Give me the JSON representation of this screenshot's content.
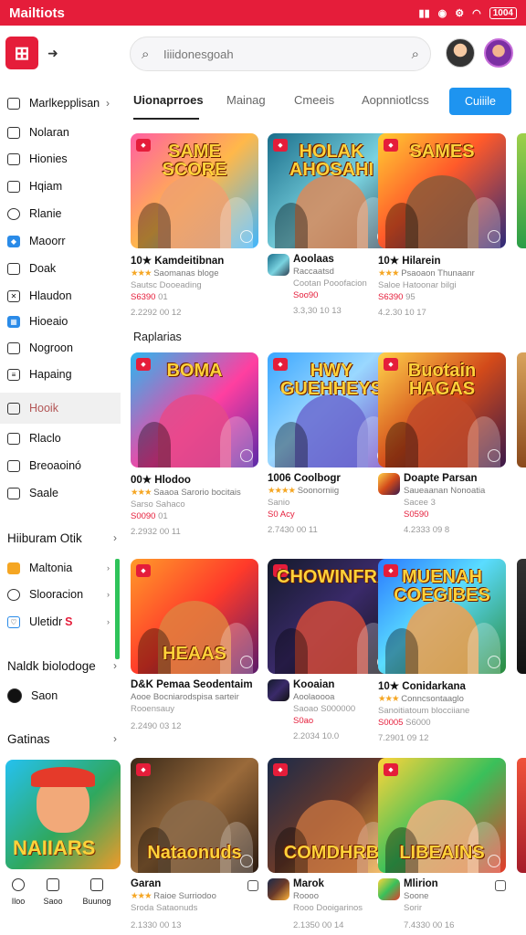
{
  "status_bar": {
    "app_name": "Mailtiots",
    "battery": "1004"
  },
  "search": {
    "placeholder": "Iiiidonesgoah"
  },
  "sidebar": {
    "items": [
      {
        "label": "Marlkepplisan",
        "chevron": "›",
        "icon": "box-icon"
      },
      {
        "label": "Nolaran",
        "icon": "chat-icon"
      },
      {
        "label": "Hionies",
        "icon": "list-icon"
      },
      {
        "label": "Hqiam",
        "icon": "image-icon"
      },
      {
        "label": "Rlanie",
        "icon": "clock-icon"
      },
      {
        "label": "Maoorr",
        "icon": "diamond-icon"
      },
      {
        "label": "Doak",
        "icon": "doc-icon"
      },
      {
        "label": "Hlaudon",
        "icon": "mail-icon"
      },
      {
        "label": "Hioeaio",
        "icon": "grid-icon"
      },
      {
        "label": "Nogroon",
        "icon": "card-icon"
      },
      {
        "label": "Hapaing",
        "icon": "menu-icon"
      },
      {
        "label": "Hooik",
        "icon": "folder-icon",
        "active": true
      },
      {
        "label": "Rlaclo",
        "icon": "check-icon"
      },
      {
        "label": "Breoaoinó",
        "icon": "doc2-icon"
      },
      {
        "label": "Saale",
        "icon": "tag-icon"
      }
    ],
    "section2": {
      "title": "Hiiburam Otik",
      "chevron": "›"
    },
    "items2": [
      {
        "label": "Maltonia",
        "icon": "orange-icon",
        "extra": "›"
      },
      {
        "label": "Slooracion",
        "icon": "pin-icon",
        "extra": "›"
      },
      {
        "label": "Uletidr",
        "badge": "S",
        "icon": "heart-icon",
        "extra": "›"
      }
    ],
    "section3": {
      "title": "Naldk biolodoge",
      "chevron": "›"
    },
    "items3": [
      {
        "label": "Saon",
        "icon": "dot-icon"
      }
    ],
    "section4": {
      "title": "Gatinas",
      "chevron": "›"
    },
    "side_thumb_title": "NAIIARS",
    "bottom_nav": [
      {
        "label": "Iloo"
      },
      {
        "label": "Saoo"
      },
      {
        "label": "Buunog"
      }
    ]
  },
  "tabs": [
    {
      "label": "Uionaprroes",
      "active": true
    },
    {
      "label": "Mainag"
    },
    {
      "label": "Cmeeis"
    },
    {
      "label": "Aopnniotlcss"
    }
  ],
  "tab_button": "Cuiiile",
  "section_label": "Raplarias",
  "cards": [
    {
      "game_title": "SAME SCORE",
      "title": "10★ Kamdeitibnan",
      "stars": "★★★",
      "sub1": "Saomanas bloge",
      "sub2": "Sautsc Dooeading",
      "price": "S6390",
      "price_suffix": "01",
      "meta": "2.2292 00 12"
    },
    {
      "game_title": "HOLAK AHOSAHI",
      "title": "Aoolaas",
      "stars": "",
      "sub1": "Raccaatsd",
      "sub2": "Cootan Pooofacion",
      "price": "Soo90",
      "price_suffix": "",
      "meta": "3.3,30 10 13"
    },
    {
      "game_title": "SAMES",
      "title": "10★ Hilarein",
      "stars": "★★★",
      "sub1": "Psaoaon Thunaanr",
      "sub2": "Saloe Hatoonar bilgi",
      "price": "S6390",
      "price_suffix": "95",
      "meta": "4.2.30 10 17"
    },
    {
      "game_title": "BOMA",
      "title": "00★ Hlodoo",
      "stars": "★★★",
      "sub1": "Saaoa Sarorio bocitais",
      "sub2": "Sarso Sahaco",
      "price": "S0090",
      "price_suffix": "01",
      "meta": "2.2932 00 11"
    },
    {
      "game_title": "HWY GUEHHEYS",
      "title": "1006 Coolbogr",
      "stars": "★★★★",
      "sub1": "Soonorniig",
      "sub2": "Sanio",
      "price": "S0 Acy",
      "price_suffix": "",
      "meta": "2.7430 00 11"
    },
    {
      "game_title": "Buotain HAGAS",
      "title": "Doapte Parsan",
      "stars": "",
      "sub1": "Saueaanan Nonoatia",
      "sub2": "Sacee 3",
      "price": "S0590",
      "price_suffix": "",
      "meta": "4.2333 09 8"
    },
    {
      "game_title": "HEAAS",
      "title": "D&K Pemaa Seodentaim",
      "stars": "",
      "sub1": "Aooe Bocniarodspisa sarteir",
      "sub2": "Rooensauy",
      "price": "",
      "price_suffix": "",
      "meta": "2.2490 03 12"
    },
    {
      "game_title": "CHOWINFRAS",
      "title": "Kooaian",
      "stars": "",
      "sub1": "Aoolaoooa",
      "sub2": "Saoao S000000",
      "price": "S0ao",
      "price_suffix": "",
      "meta": "2.2034 10.0"
    },
    {
      "game_title": "MUENAH COEGIBES",
      "title": "10★ Conidarkana",
      "stars": "★★★",
      "sub1": "Conncsontaaglo",
      "sub2": "Sanoitiatoum blocciiane",
      "price": "S0005",
      "price_suffix": "S6000",
      "meta": "7.2901 09 12"
    },
    {
      "game_title": "Nataonuds",
      "title": "Garan",
      "stars": "★★★",
      "sub1": "Raioe Surriodoo",
      "sub2": "Sroda Sataonuds",
      "price": "",
      "price_suffix": "",
      "meta": "2.1330 00 13"
    },
    {
      "game_title": "COMDHRB",
      "title": "Marok",
      "stars": "",
      "sub1": "Roooo",
      "sub2": "Rooo Dooigarinos",
      "price": "",
      "price_suffix": "",
      "meta": "2.1350 00 14"
    },
    {
      "game_title": "LIBEAINS",
      "title": "Mlirion",
      "stars": "",
      "sub1": "Soone",
      "sub2": "Sorir",
      "price": "",
      "price_suffix": "",
      "meta": "7.4330 00 16"
    }
  ],
  "colors": {
    "brand": "#e51d3a",
    "accent_blue": "#1e94f0",
    "star": "#f5a623"
  }
}
